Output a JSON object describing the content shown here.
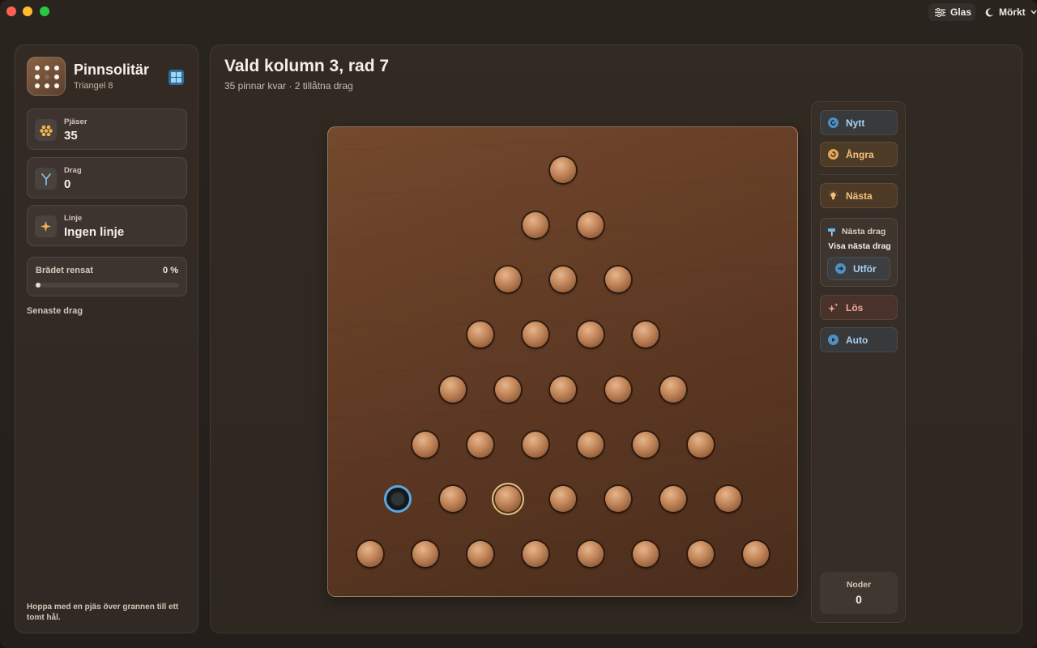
{
  "toolbar": {
    "material_label": "Glas",
    "appearance_label": "Mörkt"
  },
  "sidebar": {
    "app_title": "Pinnsolitär",
    "app_subtitle": "Triangel 8",
    "stats": [
      {
        "label": "Pjäser",
        "value": "35",
        "icon": "pegs-icon"
      },
      {
        "label": "Drag",
        "value": "0",
        "icon": "branch-icon"
      },
      {
        "label": "Linje",
        "value": "Ingen linje",
        "icon": "sparkle-icon"
      }
    ],
    "progress": {
      "label": "Brädet rensat",
      "value_text": "0 %",
      "fraction": 0
    },
    "recent_moves_heading": "Senaste drag",
    "hint": "Hoppa med en pjäs över grannen till ett tomt hål."
  },
  "main": {
    "title": "Vald kolumn 3, rad 7",
    "subtitle": "35 pinnar kvar · 2 tillåtna drag"
  },
  "board": {
    "rows": 8,
    "rows_of_cells": [
      [
        "peg"
      ],
      [
        "peg",
        "peg"
      ],
      [
        "peg",
        "peg",
        "peg"
      ],
      [
        "peg",
        "peg",
        "peg",
        "peg"
      ],
      [
        "peg",
        "peg",
        "peg",
        "peg",
        "peg"
      ],
      [
        "peg",
        "peg",
        "peg",
        "peg",
        "peg",
        "peg"
      ],
      [
        "empty",
        "peg",
        "selected",
        "peg",
        "peg",
        "peg",
        "peg"
      ],
      [
        "peg",
        "peg",
        "peg",
        "peg",
        "peg",
        "peg",
        "peg",
        "peg"
      ]
    ]
  },
  "controls": {
    "new_label": "Nytt",
    "undo_label": "Ångra",
    "hint_label": "Nästa",
    "next_move_title": "Nästa drag",
    "next_move_value": "Visa nästa drag",
    "execute_label": "Utför",
    "solve_label": "Lös",
    "auto_label": "Auto",
    "nodes_label": "Noder",
    "nodes_value": "0"
  },
  "colors": {
    "accent_blue": "#5aa8e0",
    "accent_orange": "#f3c27c",
    "accent_red": "#f2a79a",
    "selected_ring": "#e8c07e"
  }
}
